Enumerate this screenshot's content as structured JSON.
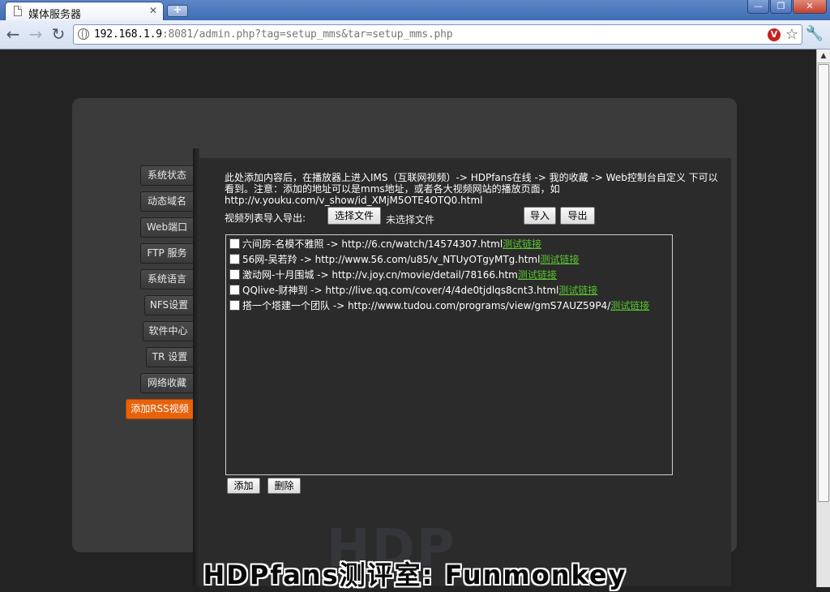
{
  "browser": {
    "tab_title": "媒体服务器",
    "tab_close": "✕",
    "new_tab": "+",
    "window_controls": {
      "minimize": "—",
      "restore": "❐",
      "close": "✕"
    },
    "nav": {
      "back": "←",
      "forward": "→",
      "reload": "↻"
    },
    "url_host": "192.168.1.9",
    "url_rest": ":8081/admin.php?tag=setup_mms&tar=setup_mms.php",
    "ext_icon": "V",
    "star": "☆",
    "wrench": "🔧"
  },
  "sidebar": {
    "items": [
      {
        "label": "系统状态"
      },
      {
        "label": "动态域名"
      },
      {
        "label": "Web端口"
      },
      {
        "label": "FTP 服务"
      },
      {
        "label": "系统语言"
      },
      {
        "label": "NFS设置"
      },
      {
        "label": "软件中心"
      },
      {
        "label": "TR 设置"
      },
      {
        "label": "网络收藏"
      },
      {
        "label": "添加RSS视频"
      }
    ],
    "active_color": "#e8620c"
  },
  "main": {
    "description_line1": "此处添加内容后，在播放器上进入IMS（互联网视频）-> HDPfans在线 -> 我的收藏 -> Web控制台自定义 下可以",
    "description_line2": "看到。注意：添加的地址可以是mms地址，或者各大视频网站的播放页面，如",
    "description_line3": "http://v.youku.com/v_show/id_XMjM5OTE4OTQ0.html",
    "import_label": "视频列表导入导出:",
    "choose_file_button": "选择文件",
    "no_file_text": "未选择文件",
    "import_button": "导入",
    "export_button": "导出",
    "items": [
      {
        "text": "六间房-名模不雅照 -> http://6.cn/watch/14574307.html",
        "link": "测试链接"
      },
      {
        "text": "56网-吴若羚 -> http://www.56.com/u85/v_NTUyOTgyMTg.html",
        "link": "测试链接"
      },
      {
        "text": "激动网-十月围城 -> http://v.joy.cn/movie/detail/78166.htm",
        "link": "测试链接"
      },
      {
        "text": "QQlive-财神到 -> http://live.qq.com/cover/4/4de0tjdlqs8cnt3.html",
        "link": "测试链接"
      },
      {
        "text": "搭一个塔建一个团队 -> http://www.tudou.com/programs/view/gmS7AUZ59P4/",
        "link": "测试链接"
      }
    ],
    "link_color": "#58c42f",
    "add_button": "添加",
    "delete_button": "删除"
  },
  "watermark_logo": "HDP",
  "watermark": "HDPfans测评室: Funmonkey"
}
